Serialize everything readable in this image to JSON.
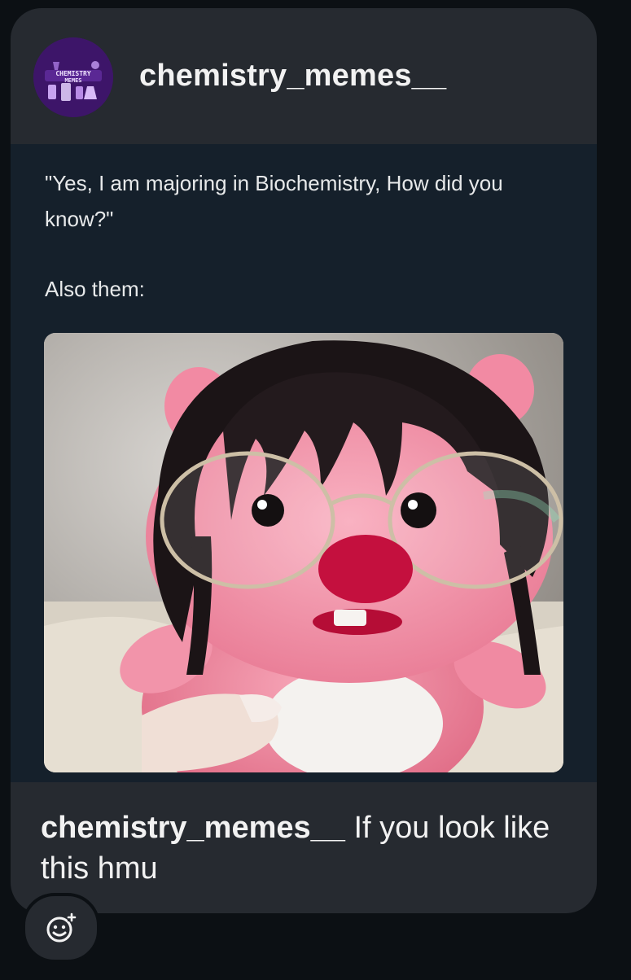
{
  "post": {
    "author": "chemistry_memes__",
    "avatar_text": "CHEMISTRY MEMES",
    "tweet_line1": "\"Yes, I am majoring in Biochemistry, How did you know?\"",
    "tweet_line2": "Also them:",
    "image_icon": "pink-plush-with-glasses-photo",
    "caption_user": "chemistry_memes__",
    "caption_text": " If you look like this hmu"
  },
  "actions": {
    "react_icon": "emoji-add-icon"
  },
  "colors": {
    "background": "#0c1014",
    "card": "#262a30",
    "tweet_background": "#15202b",
    "text": "#f2f2f2"
  }
}
